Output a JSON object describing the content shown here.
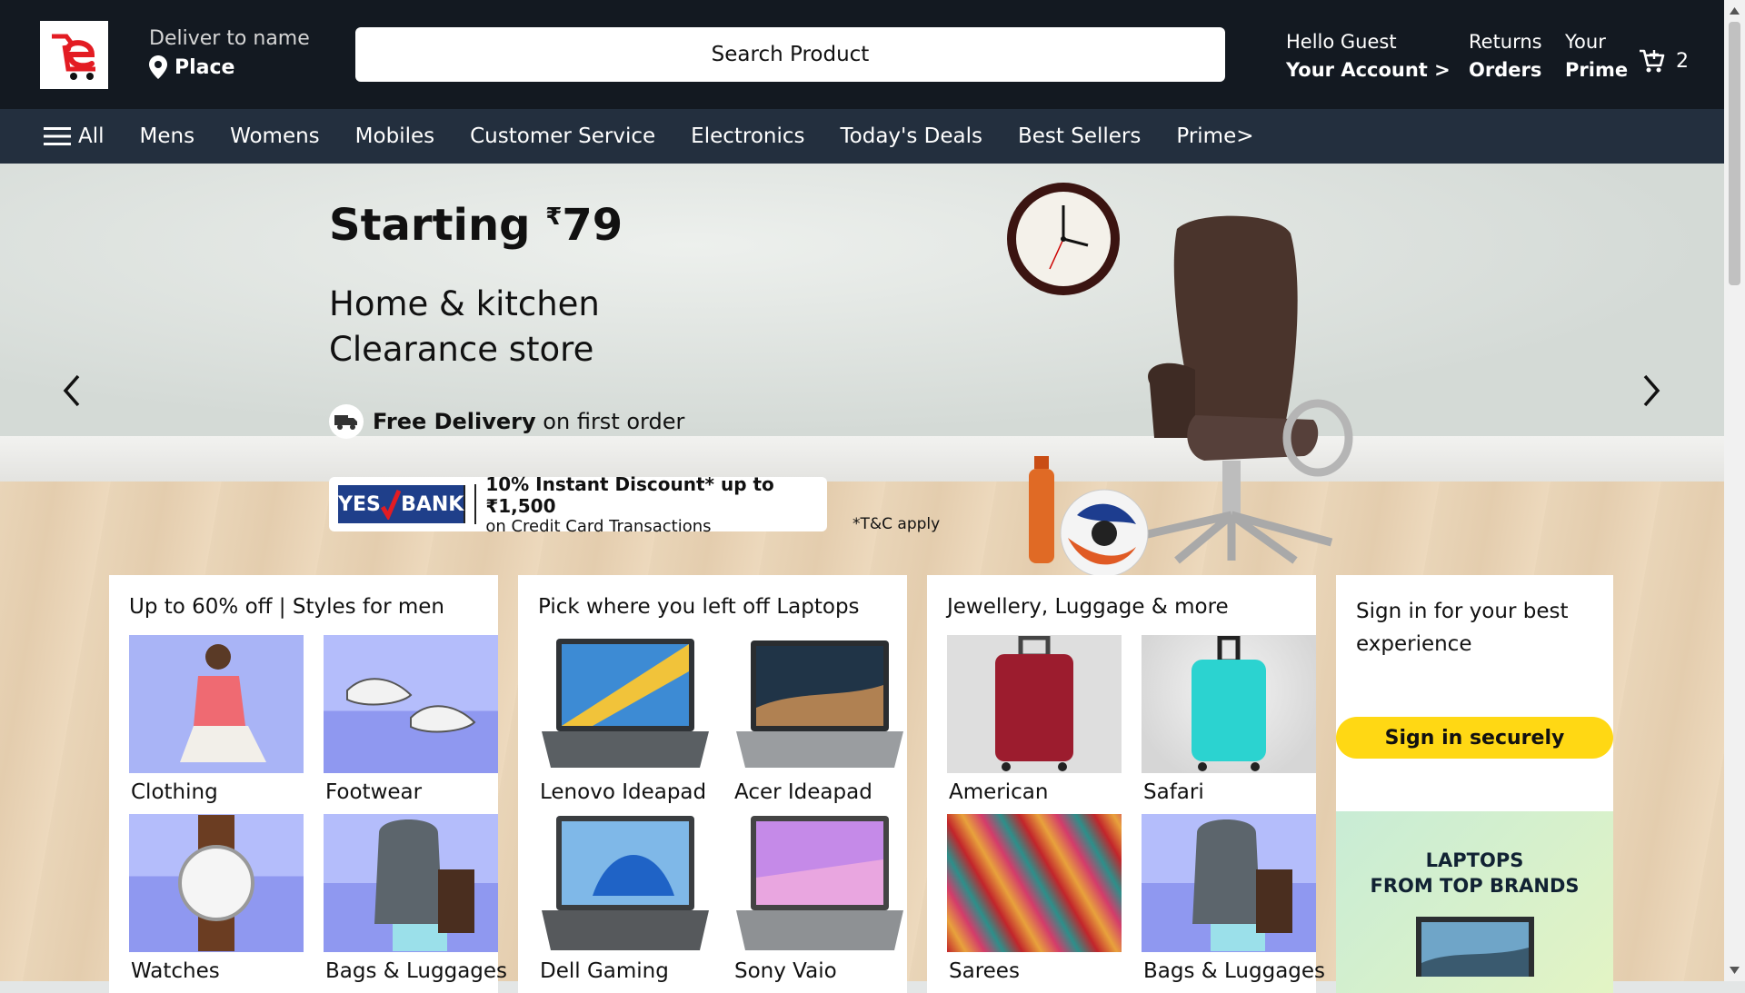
{
  "header": {
    "deliver_line1": "Deliver to name",
    "deliver_line2": "Place",
    "search_placeholder": "Search Product",
    "account_line1": "Hello Guest",
    "account_line2": "Your Account >",
    "returns_line1": "Returns",
    "returns_line2": "Orders",
    "prime_line1": "Your",
    "prime_line2": "Prime",
    "cart_count": "2"
  },
  "nav": {
    "all_label": "All",
    "items": [
      "Mens",
      "Womens",
      "Mobiles",
      "Customer Service",
      "Electronics",
      "Today's Deals",
      "Best Sellers",
      "Prime>"
    ]
  },
  "hero": {
    "title_prefix": "Starting ",
    "currency": "₹",
    "price": "79",
    "subtitle": "Home & kitchen\nClearance store",
    "free_delivery_bold": "Free Delivery",
    "free_delivery_rest": " on first order",
    "bank_name_1": "YES",
    "bank_name_2": "BANK",
    "bank_offer_line1": "10% Instant Discount* up to ₹1,500",
    "bank_offer_line2": "on Credit Card Transactions",
    "tc": "*T&C apply"
  },
  "cards": [
    {
      "title": "Up to 60% off | Styles for men",
      "tiles": [
        "Clothing",
        "Footwear",
        "Watches",
        "Bags & Luggages"
      ]
    },
    {
      "title": "Pick where you left off Laptops",
      "tiles": [
        "Lenovo Ideapad",
        "Acer Ideapad",
        "Dell Gaming",
        "Sony Vaio"
      ]
    },
    {
      "title": "Jewellery, Luggage & more",
      "tiles": [
        "American",
        "Safari",
        "Sarees",
        "Bags & Luggages"
      ]
    }
  ],
  "signin": {
    "title": "Sign in for your best\nexperience",
    "button": "Sign in securely",
    "promo": "LAPTOPS\nFROM TOP BRANDS"
  },
  "colors": {
    "header_bg": "#131921",
    "nav_bg": "#232f3e",
    "signin_button": "#ffd814",
    "logo_red": "#e31c23"
  }
}
